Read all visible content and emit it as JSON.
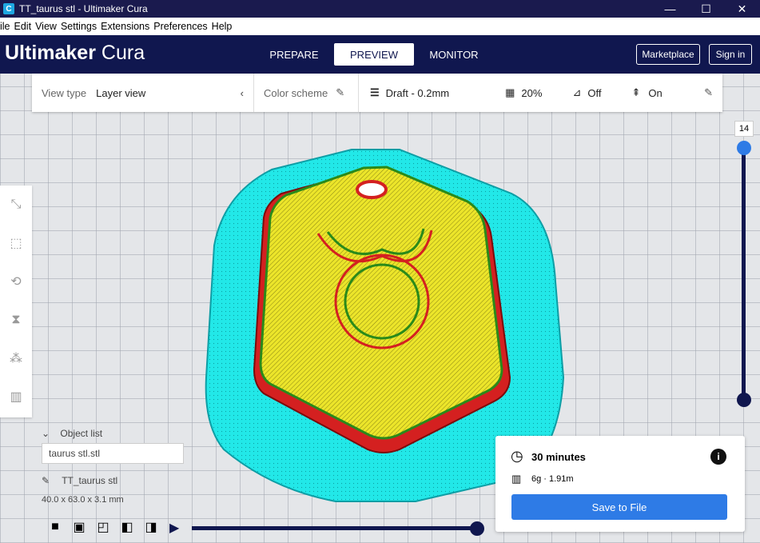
{
  "window": {
    "title": "TT_taurus stl - Ultimaker Cura",
    "app_icon": "C",
    "min": "—",
    "max": "☐",
    "close": "✕"
  },
  "menu": [
    "ile",
    "Edit",
    "View",
    "Settings",
    "Extensions",
    "Preferences",
    "Help"
  ],
  "header": {
    "logo_brand": "Ultimaker",
    "logo_product": "Cura",
    "tabs": [
      {
        "label": "PREPARE"
      },
      {
        "label": "PREVIEW"
      },
      {
        "label": "MONITOR"
      }
    ],
    "marketplace": "Marketplace",
    "signin": "Sign in"
  },
  "toolbar": {
    "view_type_label": "View type",
    "view_type_value": "Layer view",
    "color_scheme_label": "Color scheme",
    "profile": "Draft - 0.2mm",
    "infill": "20%",
    "support": "Off",
    "adhesion": "On"
  },
  "objects": {
    "list_label": "Object list",
    "list_value": "taurus stl.stl",
    "name": "TT_taurus stl",
    "dimensions": "40.0 x 63.0 x 3.1 mm"
  },
  "layer": {
    "current": "14"
  },
  "print": {
    "time": "30 minutes",
    "material": "6g · 1.91m",
    "save_label": "Save to File"
  },
  "colors": {
    "skirt": "#1fe3e3",
    "wall": "#e02020",
    "infill": "#e8e020",
    "accent": "#2e7be6",
    "header": "#10174f"
  }
}
